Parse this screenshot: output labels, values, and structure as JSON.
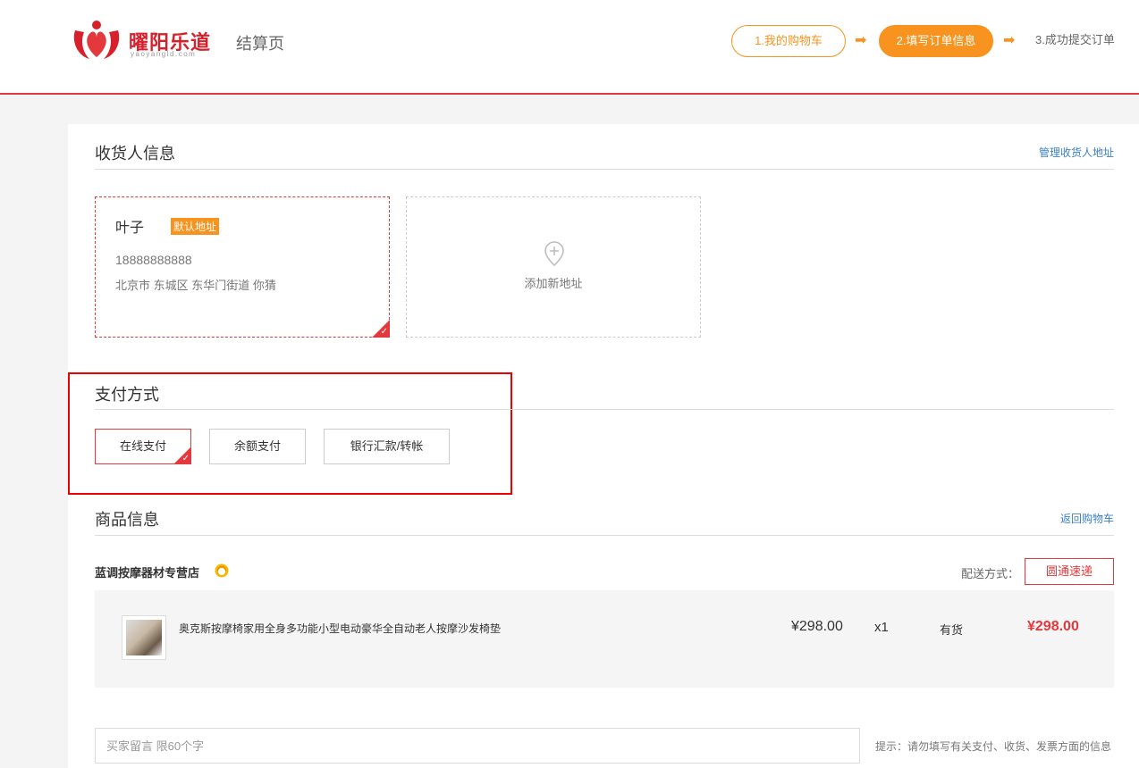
{
  "header": {
    "logo_text": "曜阳乐道",
    "logo_sub": "yaoyangld.com",
    "page_title": "结算页",
    "steps": [
      {
        "label": "1.我的购物车"
      },
      {
        "label": "2.填写订单信息"
      },
      {
        "label": "3.成功提交订单"
      }
    ],
    "step_arrow": "➡"
  },
  "consignee": {
    "title": "收货人信息",
    "manage_link": "管理收货人地址",
    "selected_address": {
      "name": "叶子",
      "badge": "默认地址",
      "phone": "18888888888",
      "address": "北京市 东城区 东华门街道   你猜"
    },
    "add_address_label": "添加新地址"
  },
  "payment": {
    "title": "支付方式",
    "options": [
      "在线支付",
      "余额支付",
      "银行汇款/转帐"
    ],
    "selected_index": 0
  },
  "goods": {
    "title": "商品信息",
    "back_link": "返回购物车",
    "shop_name": "蓝调按摩器材专营店",
    "shipping_label": "配送方式：",
    "shipping_method": "圆通速递",
    "item": {
      "name": "奥克斯按摩椅家用全身多功能小型电动豪华全自动老人按摩沙发椅垫",
      "price": "¥298.00",
      "qty": "x1",
      "stock": "有货",
      "subtotal": "¥298.00"
    }
  },
  "remark": {
    "placeholder": "买家留言 限60个字",
    "tip": "提示：请勿填写有关支付、收货、发票方面的信息"
  },
  "colors": {
    "brand_red": "#e4393c",
    "accent_orange": "#f7931e",
    "link_blue": "#3b7fc4"
  }
}
